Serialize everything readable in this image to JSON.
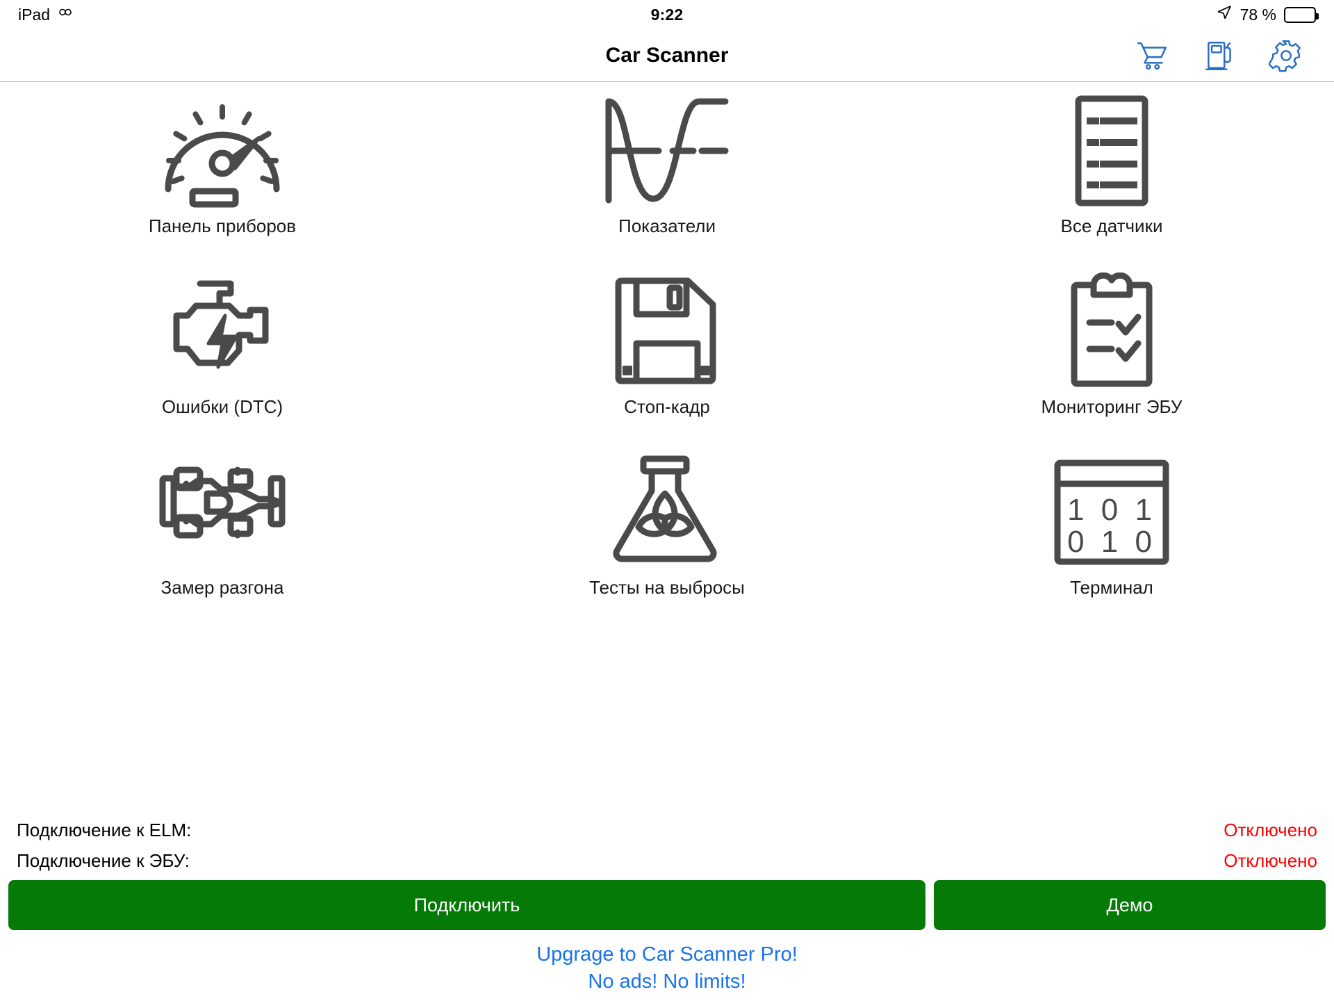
{
  "status_bar": {
    "device_label": "iPad",
    "device_icon": "sync-loop-icon",
    "time": "9:22",
    "location_icon": "location-arrow-icon",
    "battery_percent": "78 %",
    "battery_level": 78
  },
  "nav_bar": {
    "title": "Car Scanner",
    "actions": [
      {
        "name": "cart-icon",
        "label": "Shopping cart"
      },
      {
        "name": "fuel-pump-icon",
        "label": "Fuel"
      },
      {
        "name": "gear-icon",
        "label": "Settings"
      }
    ]
  },
  "grid": {
    "tiles": [
      {
        "icon": "gauge-icon",
        "label": "Панель приборов"
      },
      {
        "icon": "waveform-icon",
        "label": "Показатели"
      },
      {
        "icon": "list-document-icon",
        "label": "Все датчики"
      },
      {
        "icon": "check-engine-icon",
        "label": "Ошибки (DTC)"
      },
      {
        "icon": "floppy-disk-icon",
        "label": "Стоп-кадр"
      },
      {
        "icon": "clipboard-check-icon",
        "label": "Мониторинг ЭБУ"
      },
      {
        "icon": "race-car-icon",
        "label": "Замер разгона"
      },
      {
        "icon": "flask-leaf-icon",
        "label": "Тесты на выбросы"
      },
      {
        "icon": "terminal-binary-icon",
        "label": "Терминал"
      }
    ],
    "terminal_digits_top": "1 0 1",
    "terminal_digits_bottom": "0 1 0"
  },
  "footer": {
    "status": [
      {
        "label": "Подключение к ELM:",
        "value": "Отключено"
      },
      {
        "label": "Подключение к ЭБУ:",
        "value": "Отключено"
      }
    ],
    "buttons": {
      "connect": "Подключить",
      "demo": "Демо"
    },
    "upgrade_line1": "Upgrage to Car Scanner Pro!",
    "upgrade_line2": "No ads! No limits!"
  },
  "colors": {
    "button_green": "#067a07",
    "link_blue": "#1a73e8",
    "status_red": "#ff0000",
    "icon_gray": "#4a4a4a",
    "nav_icon_blue": "#2a6ec4"
  }
}
